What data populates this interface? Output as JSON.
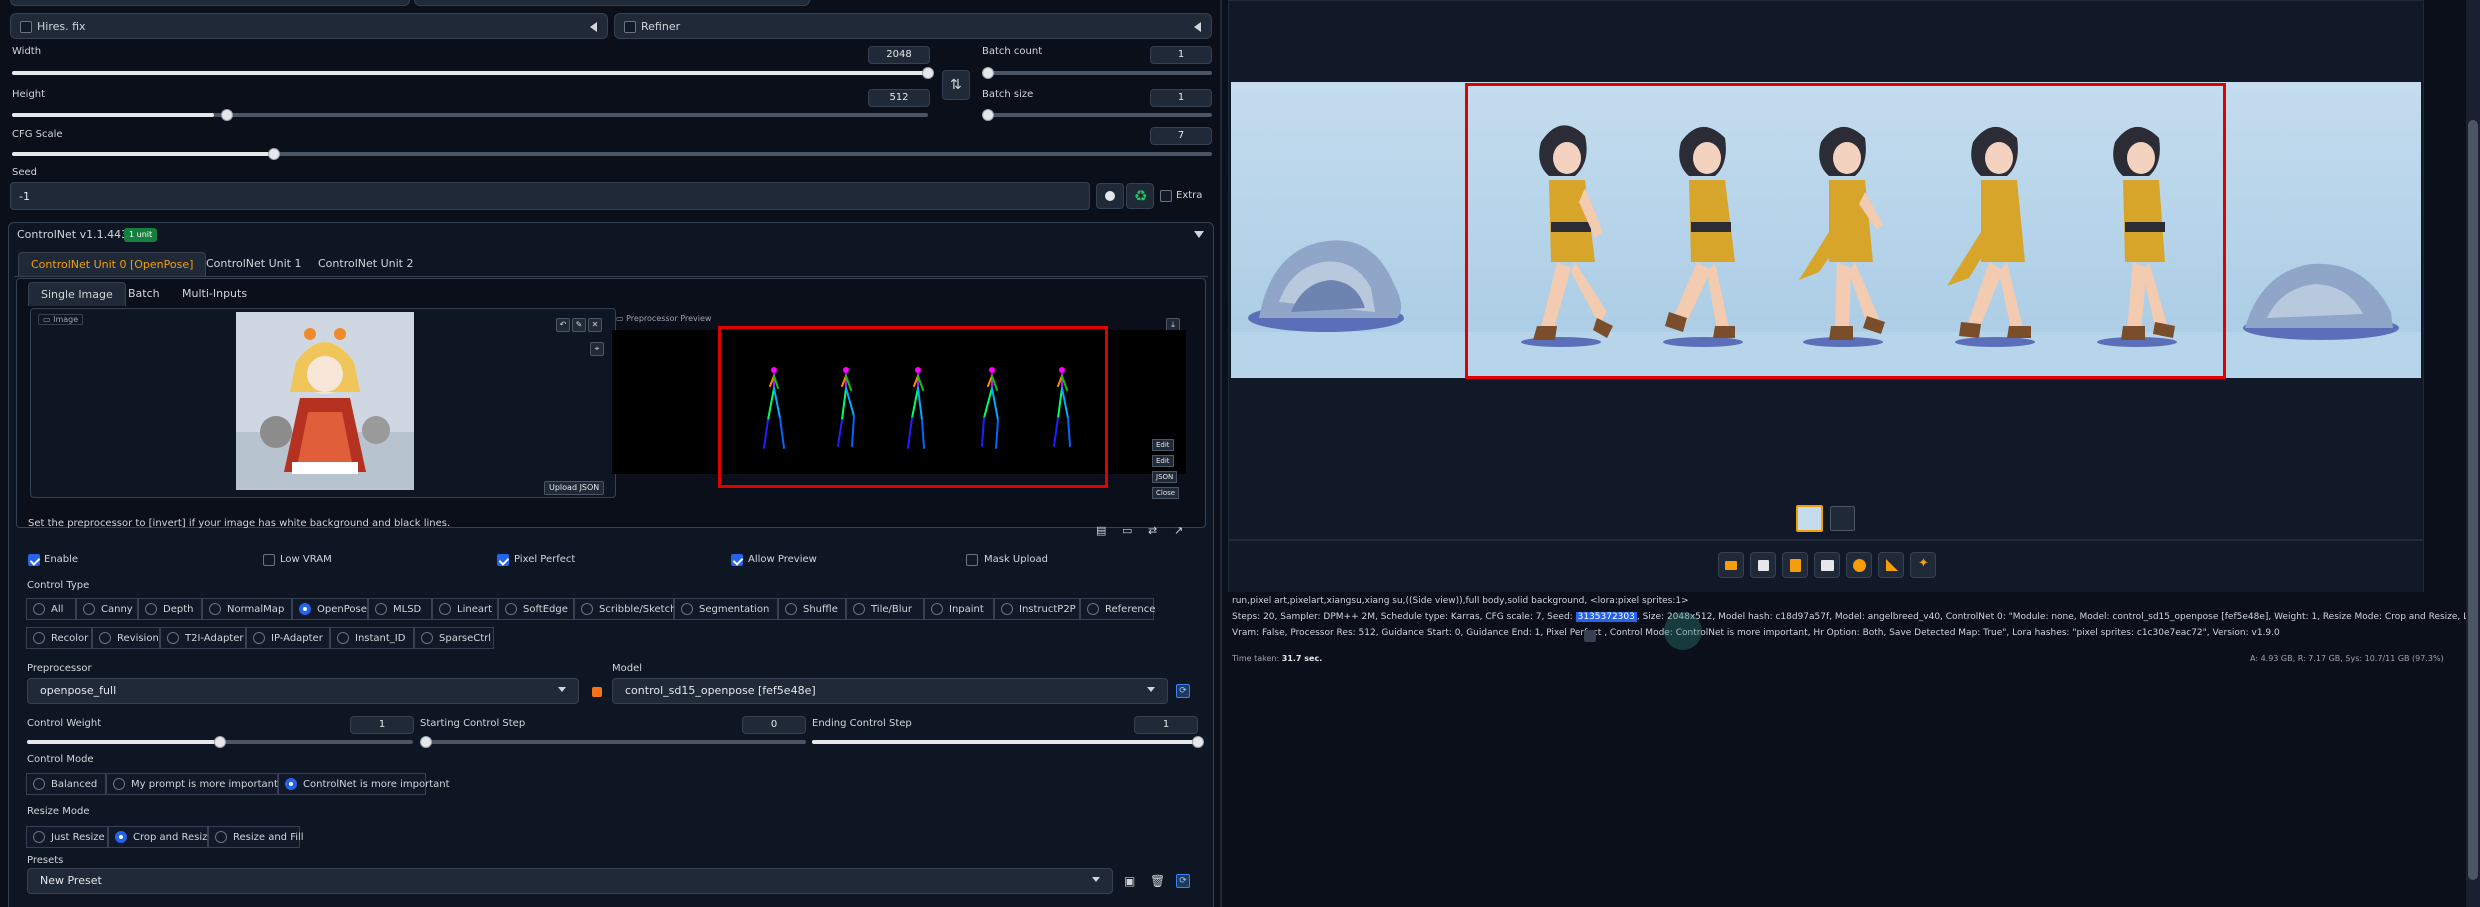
{
  "left_top": {
    "hires_label": "Hires. fix",
    "refiner_label": "Refiner"
  },
  "sliders": {
    "width": {
      "label": "Width",
      "value": "2048"
    },
    "height": {
      "label": "Height",
      "value": "512"
    },
    "batch_count": {
      "label": "Batch count",
      "value": "1"
    },
    "batch_size": {
      "label": "Batch size",
      "value": "1"
    },
    "cfg": {
      "label": "CFG Scale",
      "value": "7"
    }
  },
  "seed": {
    "label": "Seed",
    "value": "-1",
    "extra_label": "Extra"
  },
  "controlnet": {
    "title": "ControlNet v1.1.443",
    "badge": "1 unit",
    "unit_tabs": [
      "ControlNet Unit 0 [OpenPose]",
      "ControlNet Unit 1",
      "ControlNet Unit 2"
    ],
    "image_tabs": [
      "Single Image",
      "Batch",
      "Multi-Inputs"
    ],
    "image_label": "Image",
    "preview_label": "Preprocessor Preview",
    "upload_json": "Upload JSON",
    "side_buttons": [
      "Edit",
      "Edit",
      "JSON",
      "Close"
    ],
    "hint": "Set the preprocessor to [invert] if your image has white background and black lines.",
    "checks": {
      "enable": "Enable",
      "low_vram": "Low VRAM",
      "pixel_perfect": "Pixel Perfect",
      "allow_preview": "Allow Preview",
      "mask_upload": "Mask Upload"
    },
    "control_type_label": "Control Type",
    "control_types_row1": [
      "All",
      "Canny",
      "Depth",
      "NormalMap",
      "OpenPose",
      "MLSD",
      "Lineart",
      "SoftEdge",
      "Scribble/Sketch",
      "Segmentation",
      "Shuffle",
      "Tile/Blur",
      "Inpaint",
      "InstructP2P",
      "Reference"
    ],
    "control_types_row2": [
      "Recolor",
      "Revision",
      "T2I-Adapter",
      "IP-Adapter",
      "Instant_ID",
      "SparseCtrl"
    ],
    "selected_type": "OpenPose",
    "preprocessor_label": "Preprocessor",
    "preprocessor_value": "openpose_full",
    "model_label": "Model",
    "model_value": "control_sd15_openpose [fef5e48e]",
    "control_weight": {
      "label": "Control Weight",
      "value": "1"
    },
    "start_step": {
      "label": "Starting Control Step",
      "value": "0"
    },
    "end_step": {
      "label": "Ending Control Step",
      "value": "1"
    },
    "control_mode_label": "Control Mode",
    "control_modes": [
      "Balanced",
      "My prompt is more important",
      "ControlNet is more important"
    ],
    "resize_mode_label": "Resize Mode",
    "resize_modes": [
      "Just Resize",
      "Crop and Resize",
      "Resize and Fill"
    ],
    "presets_label": "Presets",
    "presets_value": "New Preset"
  },
  "output": {
    "prompt": "run,pixel art,pixelart,xiangsu,xiang su,((Side view)),full body,solid background, <lora:pixel sprites:1>",
    "params1a": "Steps: 20, Sampler: DPM++ 2M, Schedule type: Karras, CFG scale: 7, Seed:",
    "seed_value": "3135372303",
    "params1b": ", Size: 2048x512, Model hash: c18d97a57f, Model: angelbreed_v40, ControlNet 0: \"Module: none, Model: control_sd15_openpose [fef5e48e], Weight: 1, Resize Mode: Crop and Resize, Low",
    "params2a": "Vram: False, Processor Res: 512, Guidance Start: 0, Guidance End: 1, Pixel Perfect",
    "params2b": ", Control Mode: ControlNet is more important, Hr Option: Both, Save Detected Map: True\", Lora hashes: \"pixel sprites: c1c30e7eac72\", Version: v1.9.0",
    "time_label": "Time taken:",
    "time_value": "31.7 sec.",
    "vram_text": "A: 4.93 GB, R: 7.17 GB, Sys: 10.7/11 GB (97.3%)"
  },
  "colors": {
    "accent": "#f59e0b",
    "highlight_box": "#e00000",
    "background": "#0b0f19"
  }
}
